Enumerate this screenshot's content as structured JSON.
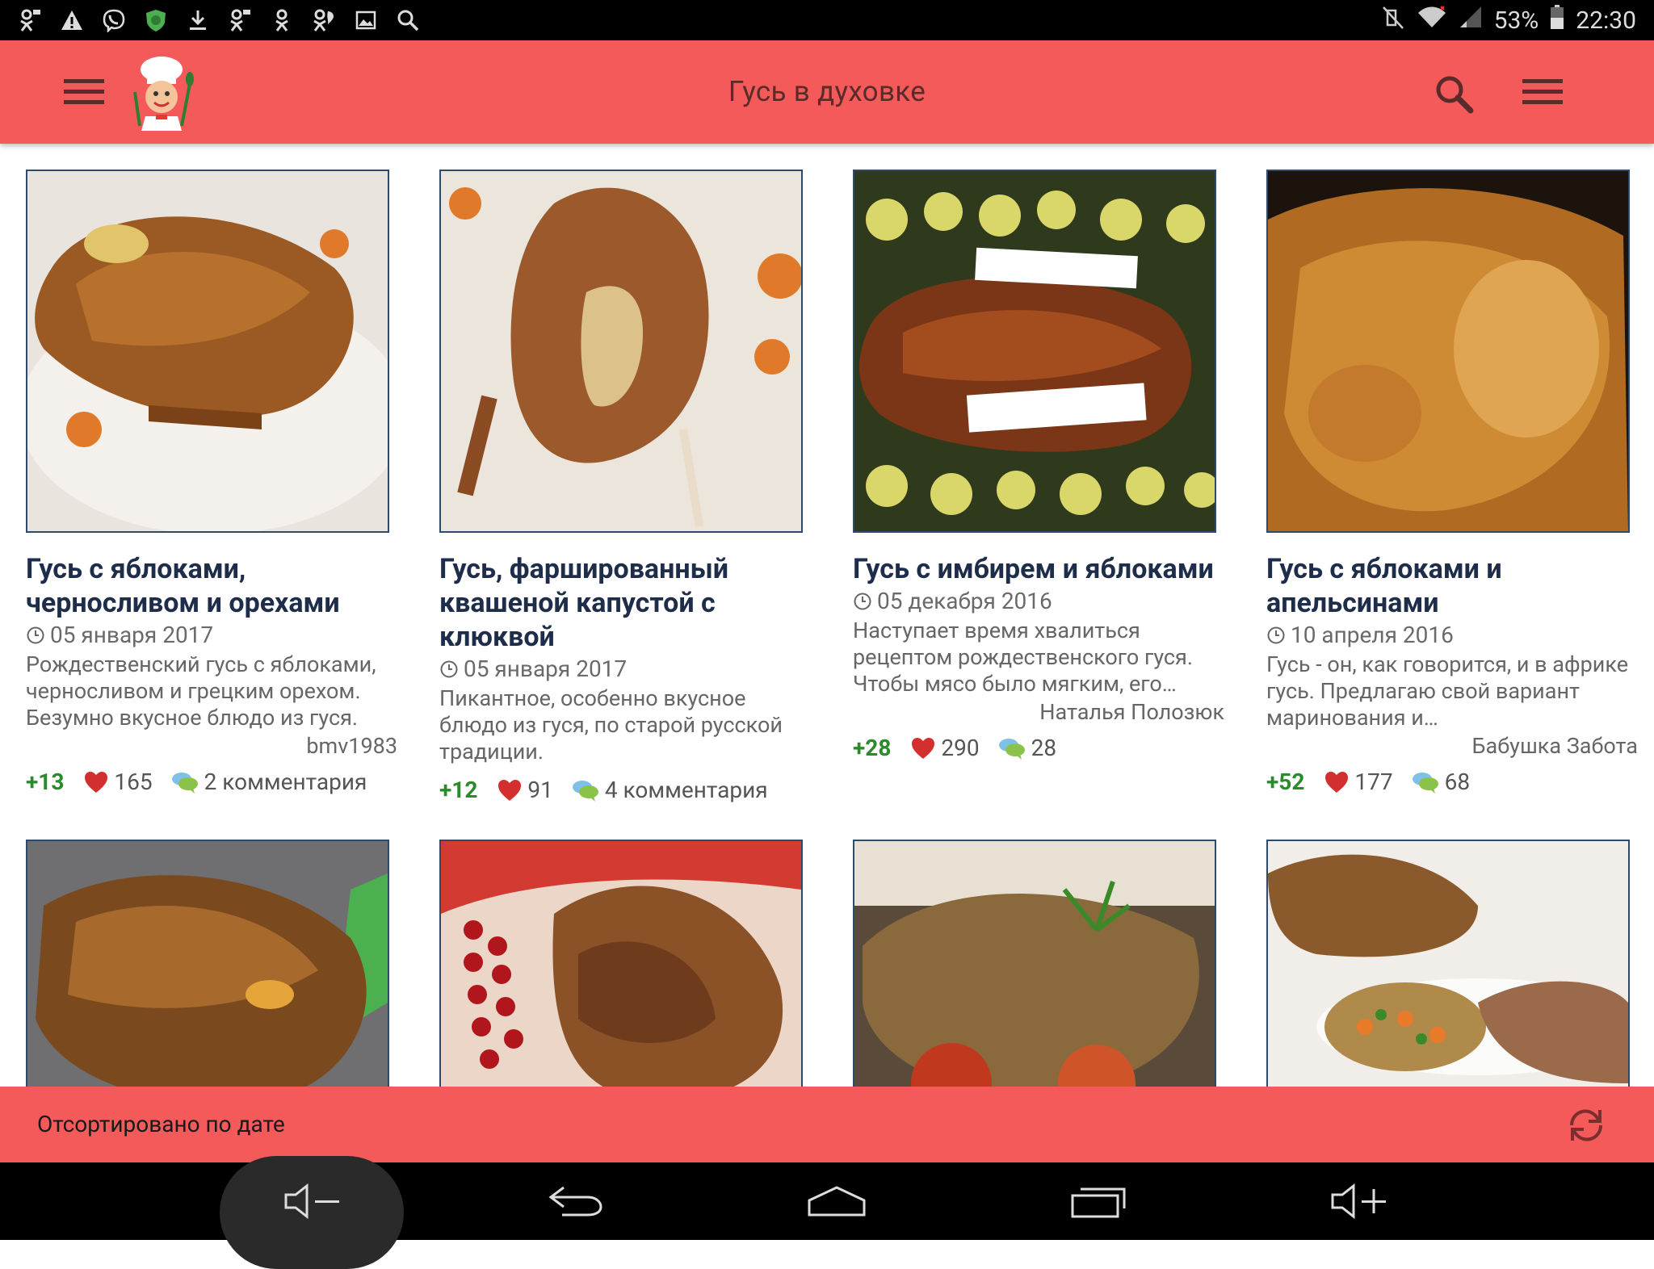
{
  "status_bar": {
    "battery": "53%",
    "time": "22:30",
    "icons": [
      "odnoklassniki-icon",
      "warning-icon",
      "viber-icon",
      "shield-icon",
      "download-icon",
      "odnoklassniki-icon",
      "odnoklassniki-icon",
      "odnoklassniki-icon",
      "image-icon",
      "search-icon"
    ]
  },
  "app_bar": {
    "title": "Гусь в духовке",
    "accent_color": "#f45a5a"
  },
  "recipes": [
    {
      "title": "Гусь с яблоками, черносливом и орехами",
      "date": "05 января 2017",
      "description": "Рождественский гусь с яблоками, черносливом и грецким орехом. Безумно вкусное блюдо из гуся.",
      "author": "bmv1983",
      "rating": "+13",
      "likes": "165",
      "comments": "2 комментария"
    },
    {
      "title": "Гусь, фаршированный квашеной капустой с клюквой",
      "date": "05 января 2017",
      "description": "Пикантное, особенно вкусное блюдо из гуся, по старой русской традиции.",
      "author": "",
      "rating": "+12",
      "likes": "91",
      "comments": "4 комментария"
    },
    {
      "title": "Гусь с имбирем и яблоками",
      "date": "05 декабря 2016",
      "description": "Наступает время хвалиться рецептом рождественского гуся. Чтобы мясо было мягким, его…",
      "author": "Наталья Полозюк",
      "rating": "+28",
      "likes": "290",
      "comments": "28"
    },
    {
      "title": "Гусь с яблоками и апельсинами",
      "date": "10 апреля 2016",
      "description": "Гусь - он, как говорится, и в африке гусь. Предлагаю свой вариант маринования и…",
      "author": "Бабушка Забота",
      "rating": "+52",
      "likes": "177",
      "comments": "68"
    }
  ],
  "bottom_bar": {
    "sort_label": "Отсортировано по дате"
  }
}
